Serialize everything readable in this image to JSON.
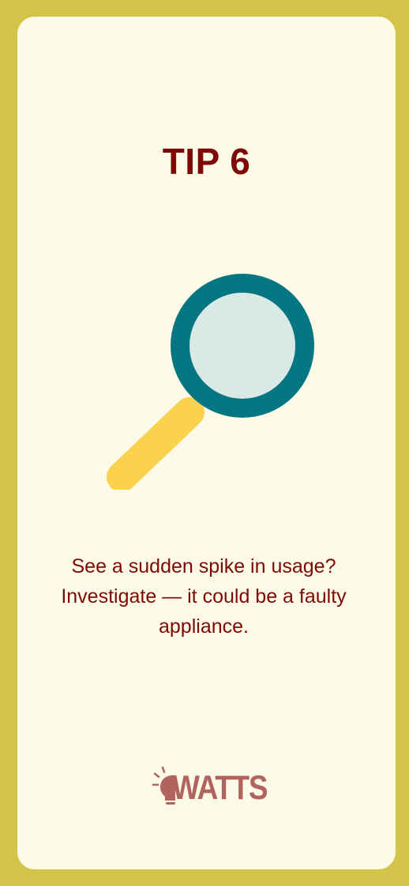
{
  "card": {
    "title": "TIP 6",
    "body": "See a sudden spike in usage? Investigate — it could be a faulty appliance."
  },
  "illustration": {
    "icon": "magnifying-glass-icon",
    "colors": {
      "rim": "#067782",
      "lens": "#d9eae6",
      "handle": "#fbd24e"
    }
  },
  "brand": {
    "name": "WATTS",
    "icon": "lightbulb-icon",
    "color": "#b1635d"
  },
  "colors": {
    "frame": "#d4c44a",
    "card": "#fdfae8",
    "text": "#7d0a05"
  }
}
